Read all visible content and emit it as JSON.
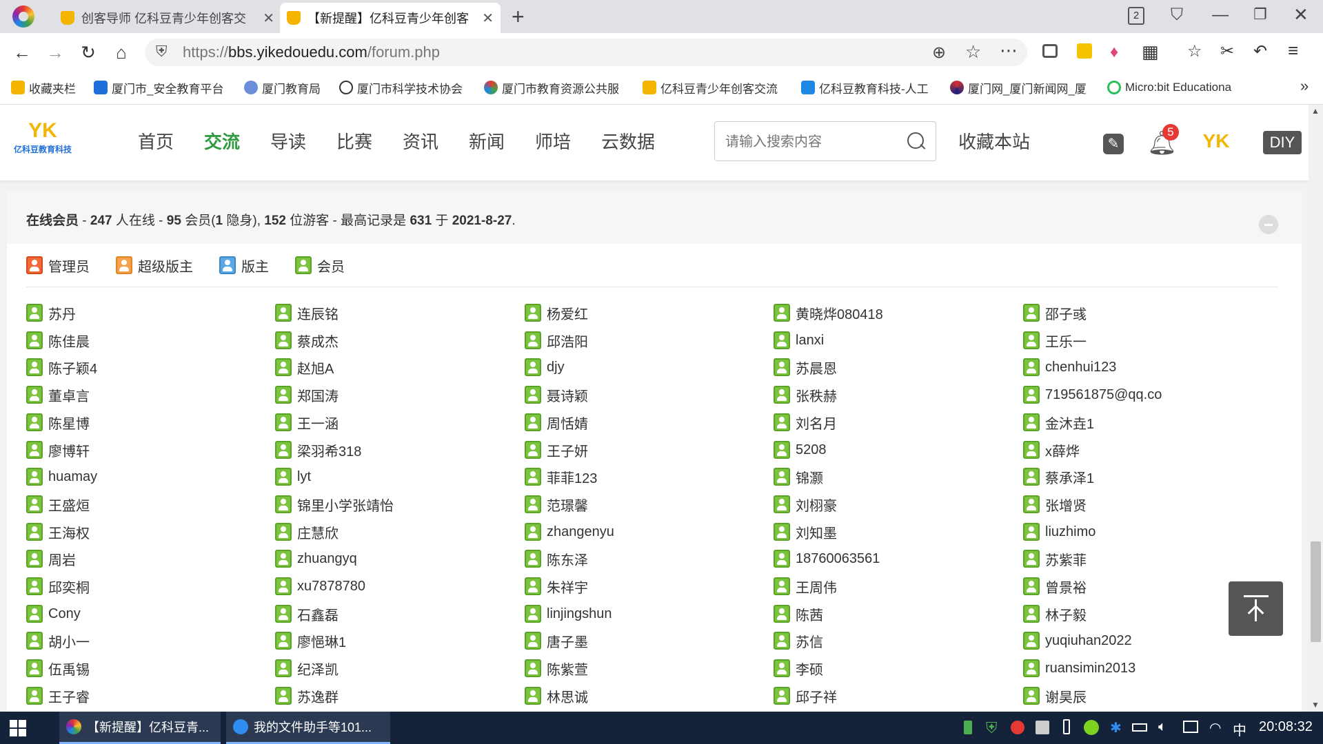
{
  "browser": {
    "tabs": [
      {
        "title": "创客导师 亿科豆青少年创客交",
        "active": false
      },
      {
        "title": "【新提醒】亿科豆青少年创客",
        "active": true
      }
    ],
    "new_tab_label": "+",
    "window_counter": "2",
    "url_scheme": "https://",
    "url_host": "bbs.yikedouedu.com",
    "url_path": "/forum.php"
  },
  "bookmarks": [
    "收藏夹栏",
    "厦门市_安全教育平台",
    "厦门教育局",
    "厦门市科学技术协会",
    "厦门市教育资源公共服",
    "亿科豆青少年创客交流",
    "亿科豆教育科技-人工",
    "厦门网_厦门新闻网_厦",
    "Micro:bit Educationa"
  ],
  "bookmarks_more": "»",
  "site": {
    "logo_text": "YK",
    "logo_sub": "亿科豆教育科技",
    "nav": [
      "首页",
      "交流",
      "导读",
      "比赛",
      "资讯",
      "新闻",
      "师培",
      "云数据"
    ],
    "nav_active_index": 1,
    "search_placeholder": "请输入搜索内容",
    "bookmark_site": "收藏本站",
    "notif_count": "5",
    "avatar_text": "YK",
    "diy_label": "DIY"
  },
  "online": {
    "title": "在线会员",
    "sep1": " - ",
    "total": "247",
    "t1": " 人在线 - ",
    "members": "95",
    "t2": " 会员(",
    "hidden": "1",
    "t3": " 隐身), ",
    "guests": "152",
    "t4": " 位游客 - 最高记录是 ",
    "record": "631",
    "t5": " 于 ",
    "record_date": "2021-8-27",
    "t6": "."
  },
  "legend": [
    {
      "label": "管理员",
      "type": "admin"
    },
    {
      "label": "超级版主",
      "type": "super"
    },
    {
      "label": "版主",
      "type": "mod"
    },
    {
      "label": "会员",
      "type": "member"
    }
  ],
  "member_columns": [
    [
      "苏丹",
      "陈佳晨",
      "陈子颖4",
      "董卓言",
      "陈星博",
      "廖博轩",
      "huamay",
      "王盛烜",
      "王海权",
      "周岩",
      "邱奕桐",
      "Cony",
      "胡小一",
      "伍禹锡",
      "王子睿"
    ],
    [
      "连辰铭",
      "蔡成杰",
      "赵旭A",
      "郑国涛",
      "王一涵",
      "梁羽希318",
      "lyt",
      "锦里小学张靖怡",
      "庄慧欣",
      "zhuangyq",
      "xu7878780",
      "石鑫磊",
      "廖悒琳1",
      "纪泽凯",
      "苏逸群"
    ],
    [
      "杨爱红",
      "邱浩阳",
      "djy",
      "聂诗颖",
      "周恬婧",
      "王子妍",
      "菲菲123",
      "范璟馨",
      "zhangenyu",
      "陈东泽",
      "朱祥宇",
      "linjingshun",
      "唐子墨",
      "陈紫萱",
      "林思诚"
    ],
    [
      "黄晓烨080418",
      "lanxi",
      "苏晨恩",
      "张秩赫",
      "刘名月",
      "5208",
      "锦灏",
      "刘栩豪",
      "刘知墨",
      "18760063561",
      "王周伟",
      "陈茜",
      "苏信",
      "李硕",
      "邱子祥"
    ],
    [
      "邵子彧",
      "王乐一",
      "chenhui123",
      "719561875@qq.co",
      "金沐垚1",
      "x薛烨",
      "蔡承泽1",
      "张增贤",
      "liuzhimo",
      "苏紫菲",
      "曾景裕",
      "林子毅",
      "yuqiuhan2022",
      "ruansimin2013",
      "谢昊辰"
    ]
  ],
  "taskbar": {
    "items": [
      "【新提醒】亿科豆青...",
      "我的文件助手等101..."
    ],
    "ime": "中",
    "clock": "20:08:32"
  },
  "colors": {
    "accent_green": "#2f9a3f",
    "taskbar": "#15233a",
    "badge_red": "#e53935"
  }
}
